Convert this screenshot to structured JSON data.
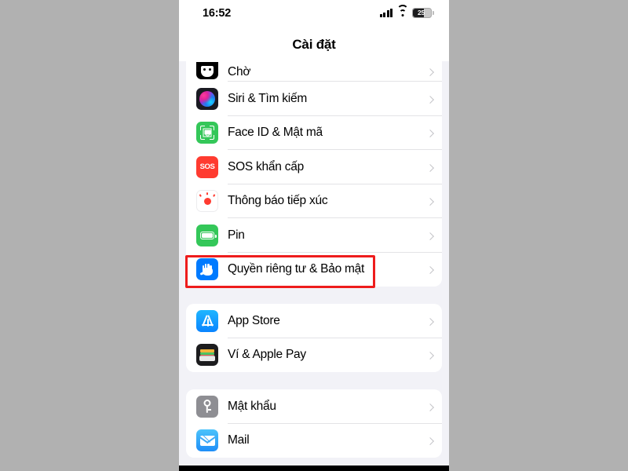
{
  "status_bar": {
    "time": "16:52",
    "cellular_icon": "signal-bars-icon",
    "wifi_icon": "wifi-icon",
    "battery_icon": "battery-icon",
    "battery_level": "25"
  },
  "nav": {
    "title": "Cài đặt"
  },
  "sections": [
    {
      "id": "section-system",
      "rows": [
        {
          "label": "Chờ",
          "icon": "screen-time-icon",
          "clipped": true,
          "chevron": "chevron-right-icon"
        },
        {
          "label": "Siri & Tìm kiếm",
          "icon": "siri-icon",
          "chevron": "chevron-right-icon"
        },
        {
          "label": "Face ID & Mật mã",
          "icon": "face-id-icon",
          "chevron": "chevron-right-icon"
        },
        {
          "label": "SOS khẩn cấp",
          "icon": "emergency-sos-icon",
          "chevron": "chevron-right-icon"
        },
        {
          "label": "Thông báo tiếp xúc",
          "icon": "exposure-notification-icon",
          "chevron": "chevron-right-icon"
        },
        {
          "label": "Pin",
          "icon": "battery-settings-icon",
          "chevron": "chevron-right-icon"
        },
        {
          "label": "Quyền riêng tư & Bảo mật",
          "icon": "privacy-hand-icon",
          "chevron": "chevron-right-icon",
          "highlighted": true
        }
      ]
    },
    {
      "id": "section-store",
      "rows": [
        {
          "label": "App Store",
          "icon": "app-store-icon",
          "chevron": "chevron-right-icon"
        },
        {
          "label": "Ví & Apple Pay",
          "icon": "wallet-icon",
          "chevron": "chevron-right-icon"
        }
      ]
    },
    {
      "id": "section-accounts",
      "rows": [
        {
          "label": "Mật khẩu",
          "icon": "passwords-key-icon",
          "chevron": "chevron-right-icon"
        },
        {
          "label": "Mail",
          "icon": "mail-icon",
          "chevron": "chevron-right-icon"
        }
      ]
    }
  ],
  "annotation": {
    "highlight_color": "#ee1c1c",
    "target_row_label": "Quyền riêng tư & Bảo mật"
  },
  "theme": {
    "page_background": "#f2f2f7",
    "card_background": "#ffffff",
    "backdrop": "#b1b1b1",
    "separator": "#e3e3e6",
    "chevron": "#c2c2c6",
    "accent_blue": "#007aff",
    "green": "#34c759",
    "red": "#ff3b30"
  }
}
